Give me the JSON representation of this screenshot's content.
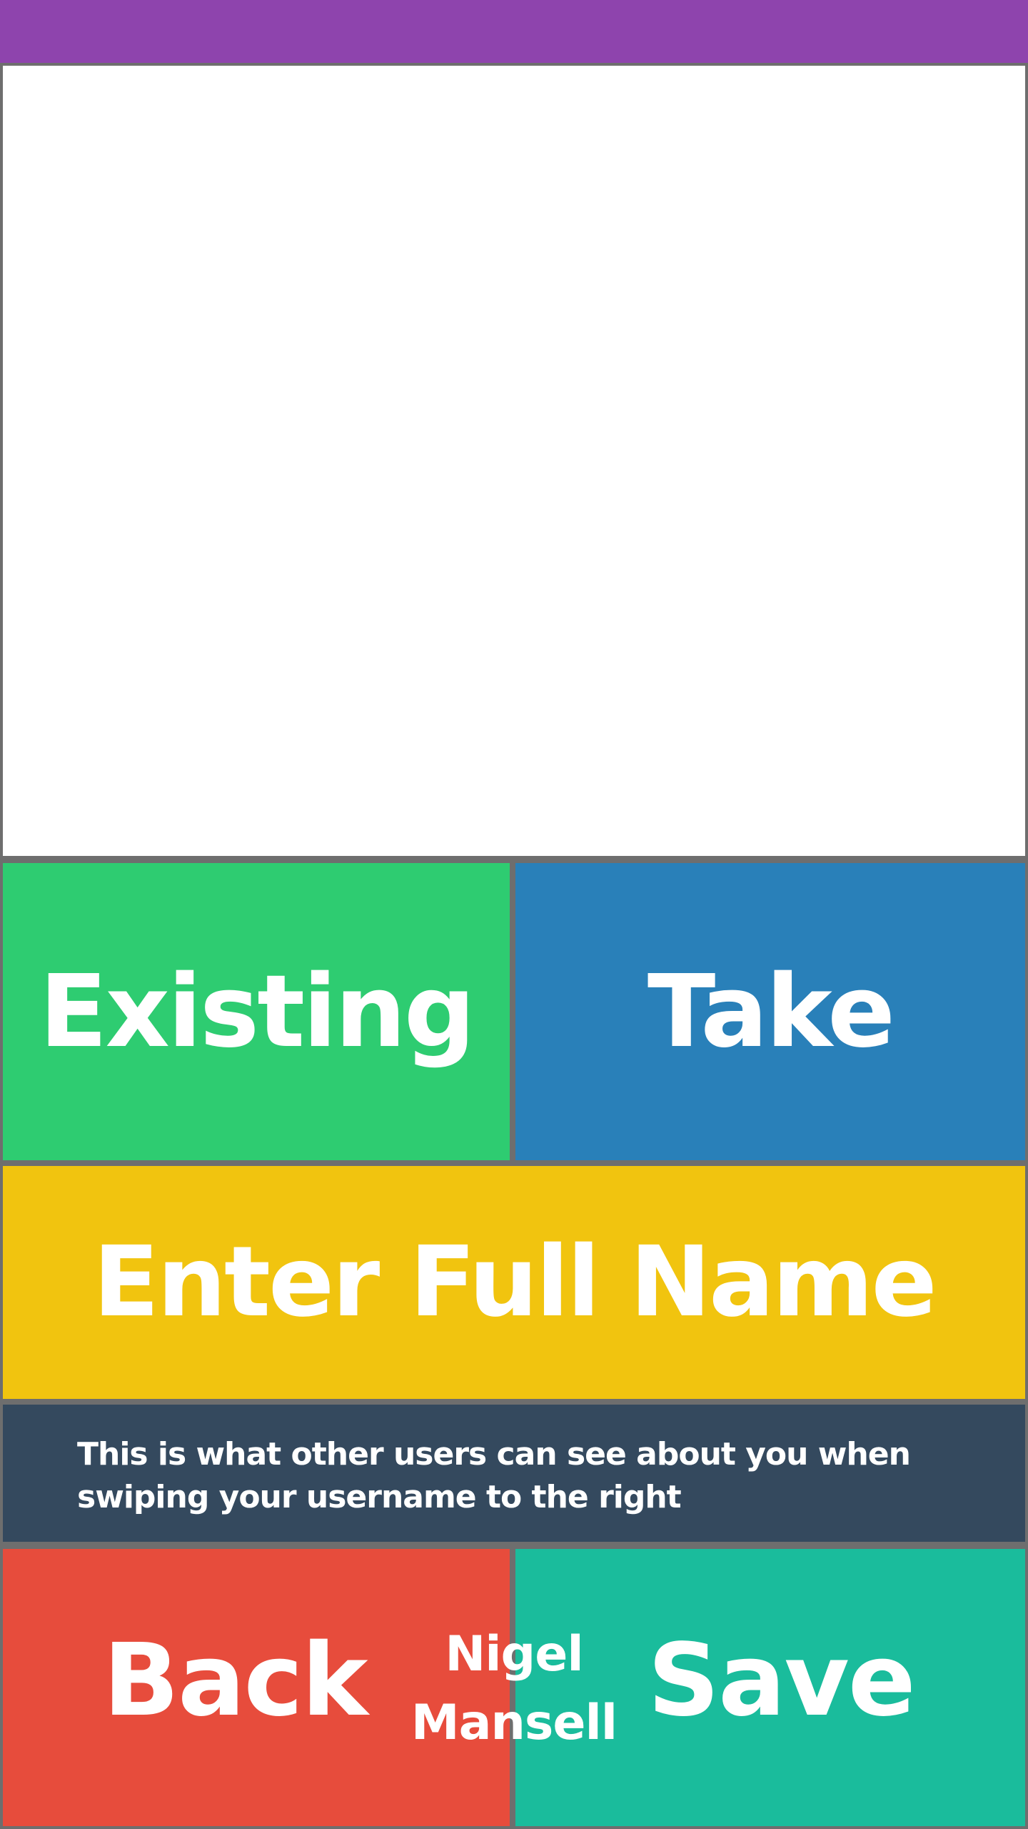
{
  "colors": {
    "status_bar": "#8e44ad",
    "existing": "#2ecc71",
    "take": "#2980b9",
    "name_field": "#f1c40f",
    "info_panel": "#34495e",
    "back": "#e74c3c",
    "save": "#1abc9c",
    "divider": "#6e6e6e"
  },
  "photo_source": {
    "existing_label": "Existing",
    "take_label": "Take"
  },
  "name_field": {
    "placeholder": "Enter Full Name"
  },
  "info": {
    "text": "This is what other users can see about you when swiping your username to the right"
  },
  "footer": {
    "back_label": "Back",
    "user_name_line1": "Nigel",
    "user_name_line2": "Mansell",
    "save_label": "Save"
  }
}
